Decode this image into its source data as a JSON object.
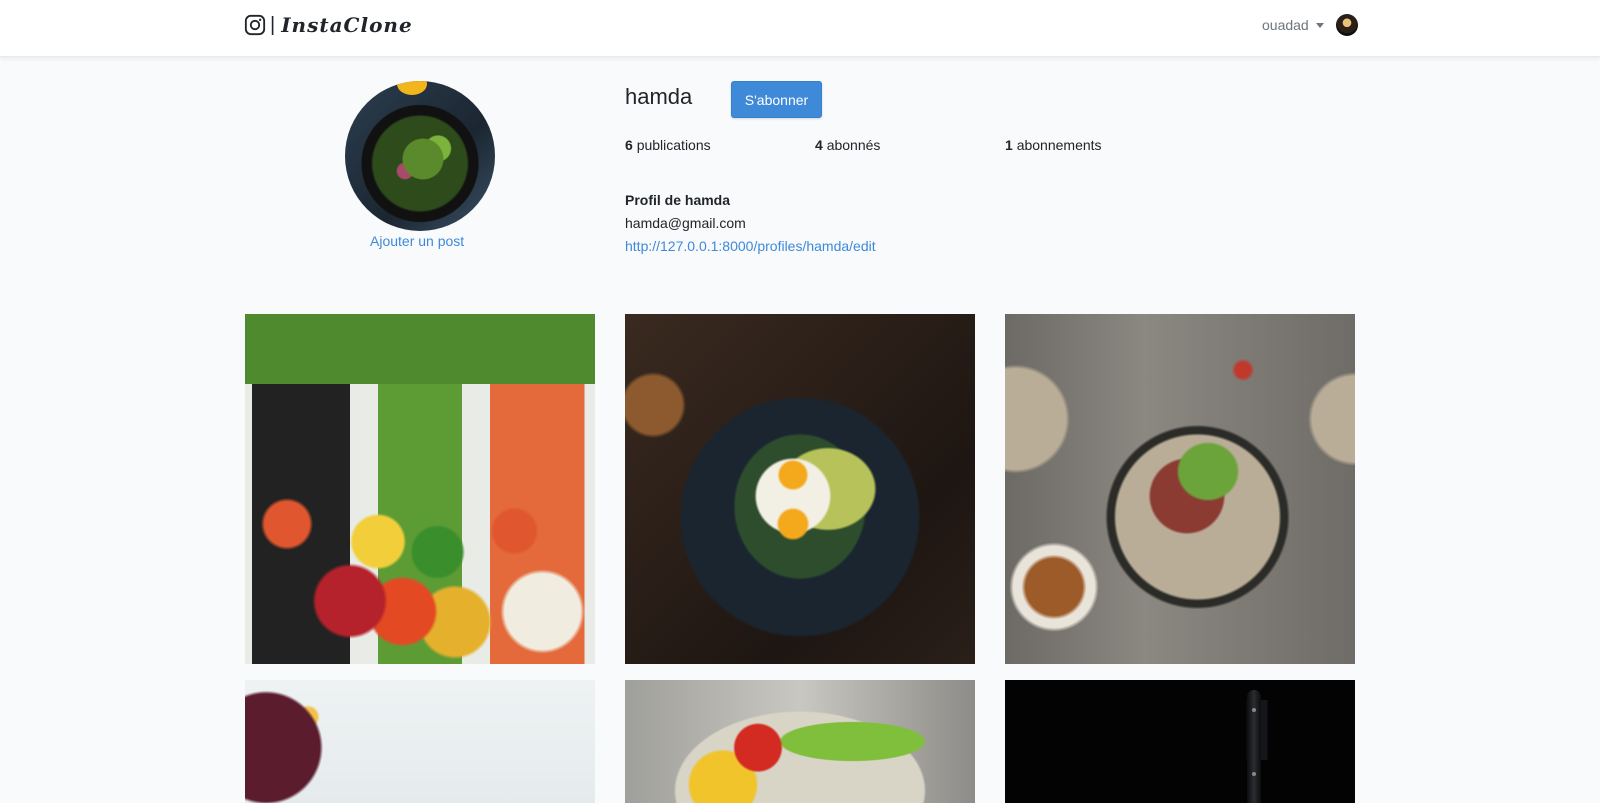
{
  "navbar": {
    "brand_separator": "|",
    "brand_name": "InstaClone",
    "brand_icon": "instagram-icon",
    "username": "ouadad"
  },
  "profile": {
    "username": "hamda",
    "subscribe_label": "S'abonner",
    "add_post_label": "Ajouter un post",
    "stats": {
      "publications_count": "6",
      "publications_label": "publications",
      "followers_count": "4",
      "followers_label": "abonnés",
      "following_count": "1",
      "following_label": "abonnements"
    },
    "bio_title": "Profil de hamda",
    "email": "hamda@gmail.com",
    "edit_link": "http://127.0.0.1:8000/profiles/hamda/edit"
  },
  "posts": [
    {
      "subject": "vegetable-bowls-photo"
    },
    {
      "subject": "egg-avocado-toast-photo"
    },
    {
      "subject": "steak-salad-plate-photo"
    },
    {
      "subject": "berries-photo"
    },
    {
      "subject": "salad-bowl-photo"
    },
    {
      "subject": "knife-dark-photo"
    }
  ],
  "colors": {
    "accent": "#3f8ad8",
    "background": "#f8fafc",
    "navbar": "#ffffff"
  }
}
